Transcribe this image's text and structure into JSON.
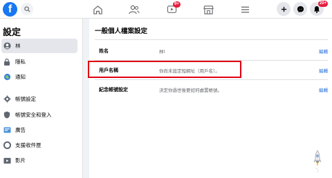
{
  "topbar": {
    "logo_letter": "f",
    "video_badge": "9+",
    "notifications_badge": "20+"
  },
  "sidebar": {
    "title": "設定",
    "items": [
      {
        "label": "林",
        "icon": "user-icon",
        "active": true
      },
      {
        "label": "隱私",
        "icon": "lock-icon",
        "active": false
      },
      {
        "label": "通知",
        "icon": "globe-icon",
        "active": false
      },
      {
        "label": "帳號設定",
        "icon": "gear-icon",
        "active": false
      },
      {
        "label": "帳號安全和登入",
        "icon": "shield-icon",
        "active": false
      },
      {
        "label": "廣告",
        "icon": "ad-icon",
        "active": false
      },
      {
        "label": "支援收件匣",
        "icon": "lifebuoy-icon",
        "active": false
      },
      {
        "label": "影片",
        "icon": "film-icon",
        "active": false
      }
    ]
  },
  "main": {
    "title": "一般個人檔案設定",
    "rows": [
      {
        "label": "姓名",
        "value": "林l",
        "edit": "編輯"
      },
      {
        "label": "用戶名稱",
        "value": "你尚未設定短網址（用戶名）。",
        "edit": "編輯"
      },
      {
        "label": "紀念帳號設定",
        "value": "決定你過世後要如何處置帳號。",
        "edit": "編輯"
      }
    ]
  },
  "colors": {
    "brand": "#1877f2",
    "link": "#216fdb",
    "highlight": "#e0000f",
    "badge": "#e41e3f"
  }
}
